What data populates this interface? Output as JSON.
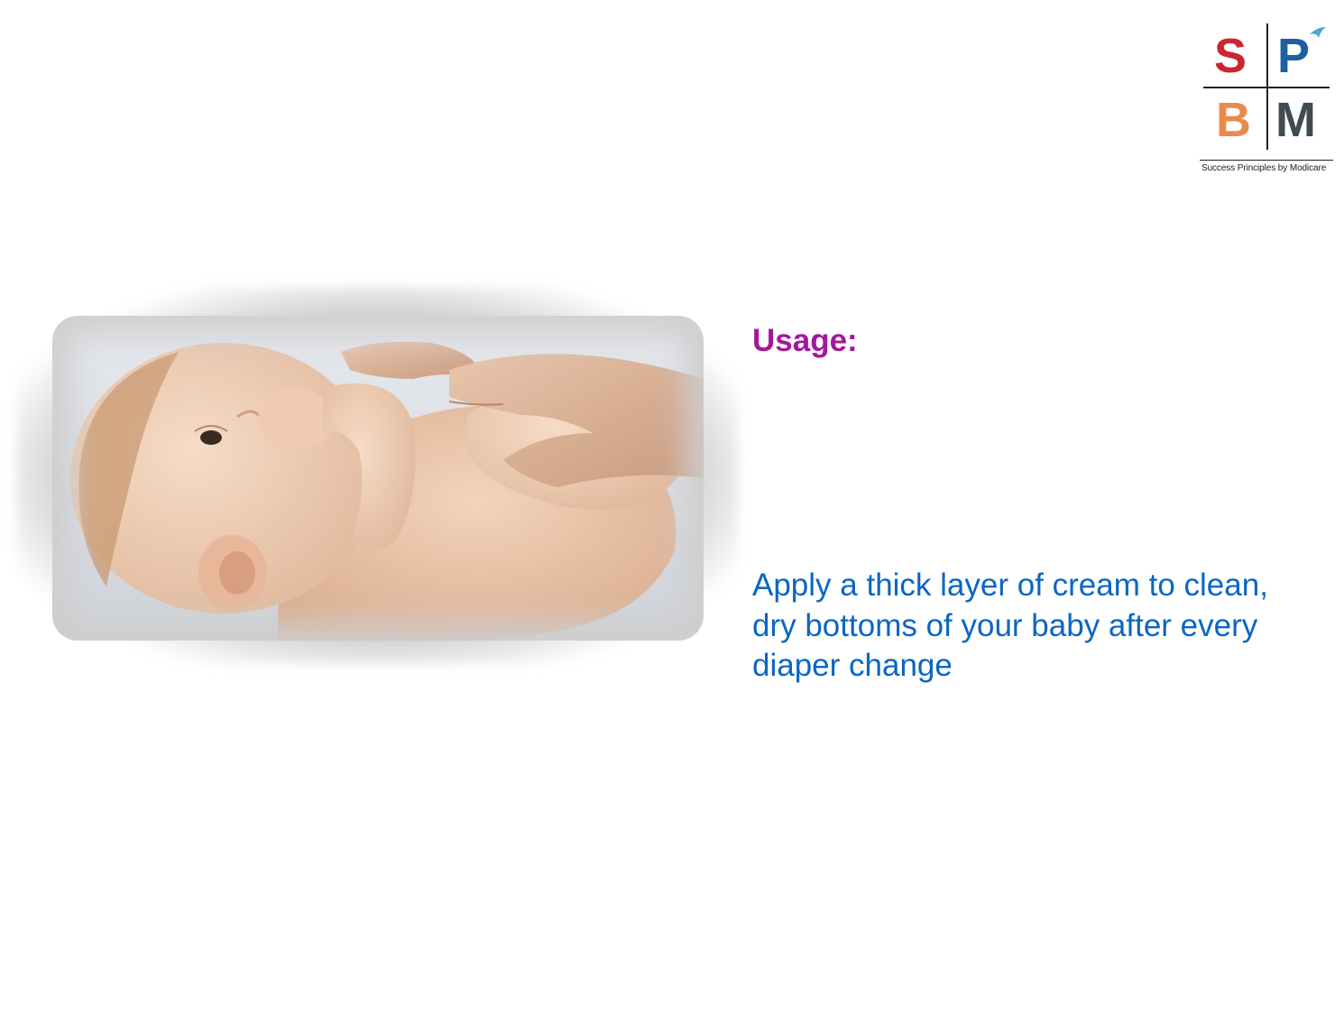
{
  "logo": {
    "letters": {
      "s": "S",
      "p": "P",
      "b": "B",
      "m": "M"
    },
    "tagline": "Success Principles by Modicare",
    "colors": {
      "s": "#cc2631",
      "p": "#1d5fa0",
      "b": "#ec8a4c",
      "m": "#414b51",
      "swoosh": "#4aa6dc"
    }
  },
  "photo": {
    "subject": "baby-lying-on-back-with-adult-hands"
  },
  "content": {
    "heading": "Usage:",
    "body": "Apply a thick layer of cream to clean, dry bottoms of your baby after every diaper change"
  },
  "colors": {
    "heading": "#a2189c",
    "body": "#0b66c2"
  }
}
